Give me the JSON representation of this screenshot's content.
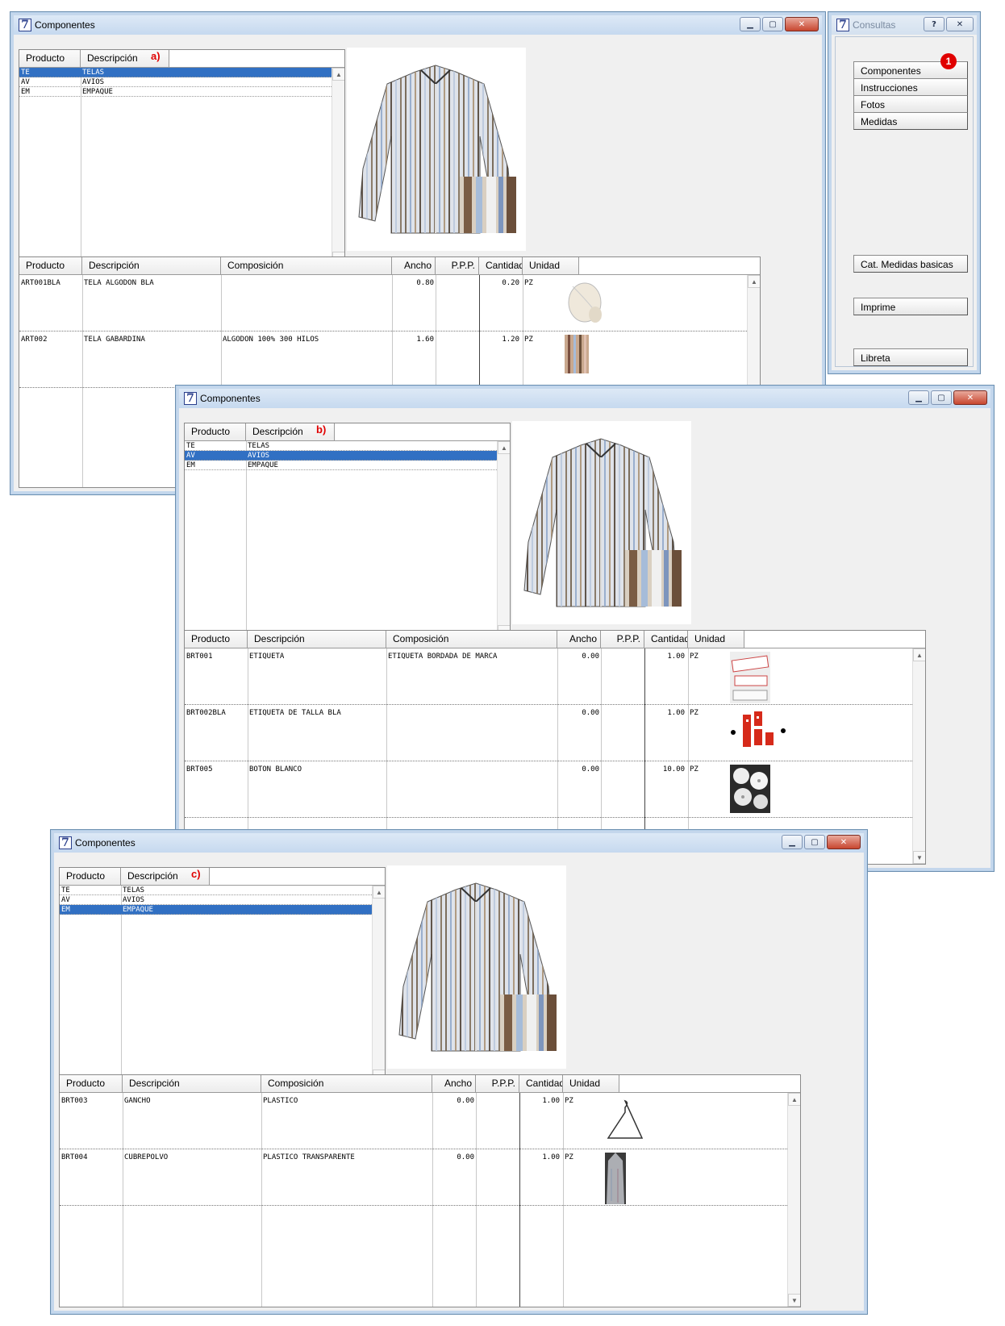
{
  "consultas": {
    "title": "Consultas",
    "help_label": "?",
    "close_label": "✕",
    "badge": "1",
    "buttons": [
      "Componentes",
      "Instrucciones",
      "Fotos",
      "Medidas",
      "Cat. Medidas basicas",
      "Imprime",
      "Libreta"
    ]
  },
  "icons": {
    "minimize": "minimize-icon",
    "maximize": "maximize-icon",
    "close": "close-icon",
    "app": "app-logo-icon"
  },
  "colors": {
    "selection": "#3170c3",
    "annotation": "#e00000",
    "titlebar": "#c6d9ef"
  },
  "windows": [
    {
      "title": "Componentes",
      "annotation": "a)",
      "category_headers": [
        "Producto",
        "Descripción"
      ],
      "categories": [
        {
          "code": "TE",
          "desc": "TELAS",
          "selected": true
        },
        {
          "code": "AV",
          "desc": "AVIOS",
          "selected": false
        },
        {
          "code": "EM",
          "desc": "EMPAQUE",
          "selected": false
        }
      ],
      "detail_headers": [
        "Producto",
        "Descripción",
        "Composición",
        "Ancho",
        "P.P.P.",
        "Cantidad",
        "Unidad"
      ],
      "items": [
        {
          "producto": "ART001BLA",
          "descripcion": "TELA ALGODON BLA",
          "composicion": "",
          "ancho": "0.80",
          "ppp": "",
          "cantidad": "0.20",
          "unidad": "PZ",
          "image": "fabric-roll"
        },
        {
          "producto": "ART002",
          "descripcion": "TELA GABARDINA",
          "composicion": "ALGODON 100% 300 HILOS",
          "ancho": "1.60",
          "ppp": "",
          "cantidad": "1.20",
          "unidad": "PZ",
          "image": "fabric-swatch"
        }
      ]
    },
    {
      "title": "Componentes",
      "annotation": "b)",
      "category_headers": [
        "Producto",
        "Descripción"
      ],
      "categories": [
        {
          "code": "TE",
          "desc": "TELAS",
          "selected": false
        },
        {
          "code": "AV",
          "desc": "AVIOS",
          "selected": true
        },
        {
          "code": "EM",
          "desc": "EMPAQUE",
          "selected": false
        }
      ],
      "detail_headers": [
        "Producto",
        "Descripción",
        "Composición",
        "Ancho",
        "P.P.P.",
        "Cantidad",
        "Unidad"
      ],
      "items": [
        {
          "producto": "BRT001",
          "descripcion": "ETIQUETA",
          "composicion": "ETIQUETA BORDADA DE MARCA",
          "ancho": "0.00",
          "ppp": "",
          "cantidad": "1.00",
          "unidad": "PZ",
          "image": "label"
        },
        {
          "producto": "BRT002BLA",
          "descripcion": "ETIQUETA DE TALLA BLA",
          "composicion": "",
          "ancho": "0.00",
          "ppp": "",
          "cantidad": "1.00",
          "unidad": "PZ",
          "image": "size-tags"
        },
        {
          "producto": "BRT005",
          "descripcion": "BOTON BLANCO",
          "composicion": "",
          "ancho": "0.00",
          "ppp": "",
          "cantidad": "10.00",
          "unidad": "PZ",
          "image": "buttons"
        }
      ]
    },
    {
      "title": "Componentes",
      "annotation": "c)",
      "category_headers": [
        "Producto",
        "Descripción"
      ],
      "categories": [
        {
          "code": "TE",
          "desc": "TELAS",
          "selected": false
        },
        {
          "code": "AV",
          "desc": "AVIOS",
          "selected": false
        },
        {
          "code": "EM",
          "desc": "EMPAQUE",
          "selected": true
        }
      ],
      "detail_headers": [
        "Producto",
        "Descripción",
        "Composición",
        "Ancho",
        "P.P.P.",
        "Cantidad",
        "Unidad"
      ],
      "items": [
        {
          "producto": "BRT003",
          "descripcion": "GANCHO",
          "composicion": "PLASTICO",
          "ancho": "0.00",
          "ppp": "",
          "cantidad": "1.00",
          "unidad": "PZ",
          "image": "hanger"
        },
        {
          "producto": "BRT004",
          "descripcion": "CUBREPOLVO",
          "composicion": "PLASTICO TRANSPARENTE",
          "ancho": "0.00",
          "ppp": "",
          "cantidad": "1.00",
          "unidad": "PZ",
          "image": "garment-bag"
        }
      ]
    }
  ]
}
